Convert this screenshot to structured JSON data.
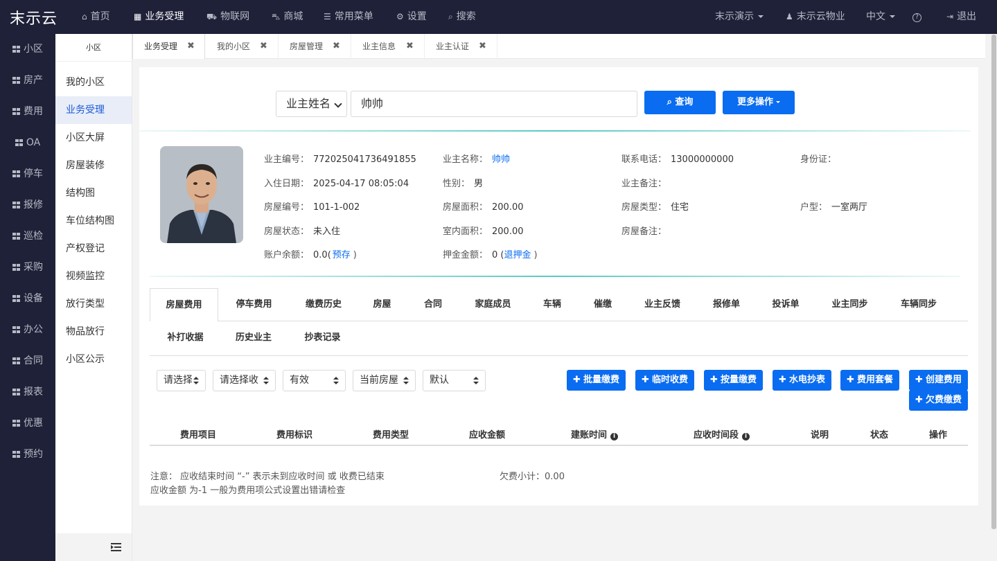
{
  "topbar": {
    "logo": "末示云",
    "nav": [
      {
        "icon": "home-icon",
        "label": "首页"
      },
      {
        "icon": "calculator-icon",
        "label": "业务受理"
      },
      {
        "icon": "car-icon",
        "label": "物联网"
      },
      {
        "icon": "cart-icon",
        "label": "商城"
      },
      {
        "icon": "menu-icon",
        "label": "常用菜单"
      },
      {
        "icon": "gear-icon",
        "label": "设置"
      },
      {
        "icon": "search-icon",
        "label": "搜索"
      }
    ],
    "right": {
      "demo": "末示演示",
      "user": "末示云物业",
      "lang": "中文",
      "help": "?",
      "logout": "退出"
    }
  },
  "leftbar": {
    "items": [
      "小区",
      "房产",
      "费用",
      "OA",
      "停车",
      "报修",
      "巡检",
      "采购",
      "设备",
      "办公",
      "合同",
      "报表",
      "优惠",
      "预约"
    ]
  },
  "subbar": {
    "title": "小区",
    "items": [
      "我的小区",
      "业务受理",
      "小区大屏",
      "房屋装修",
      "结构图",
      "车位结构图",
      "产权登记",
      "视频监控",
      "放行类型",
      "物品放行",
      "小区公示"
    ],
    "active": "业务受理"
  },
  "tabs": [
    "业务受理",
    "我的小区",
    "房屋管理",
    "业主信息",
    "业主认证"
  ],
  "search": {
    "type": "业主姓名",
    "value": "帅帅",
    "query_btn": "查询",
    "more_btn": "更多操作"
  },
  "owner": {
    "labels": {
      "code": "业主编号：",
      "name": "业主名称：",
      "phone": "联系电话：",
      "idcard": "身份证：",
      "checkin": "入住日期：",
      "gender": "性别：",
      "remark": "业主备注：",
      "room_no": "房屋编号：",
      "area": "房屋面积：",
      "room_type": "房屋类型：",
      "layout": "户型：",
      "room_status": "房屋状态：",
      "inner_area": "室内面积：",
      "room_remark": "房屋备注：",
      "balance": "账户余额：",
      "deposit": "押金金额："
    },
    "code": "772025041736491855",
    "name": "帅帅",
    "phone": "13000000000",
    "idcard": "",
    "checkin": "2025-04-17 08:05:04",
    "gender": "男",
    "remark": "",
    "room_no": "101-1-002",
    "area": "200.00",
    "room_type": "住宅",
    "layout": "一室两厅",
    "room_status": "未入住",
    "inner_area": "200.00",
    "room_remark": "",
    "balance": "0.0(",
    "balance_link": "预存",
    "balance_end": ")",
    "deposit": "0 (",
    "deposit_link": "退押金",
    "deposit_end": ")"
  },
  "detail_tabs_row1": [
    "房屋费用",
    "停车费用",
    "缴费历史",
    "房屋",
    "合同",
    "家庭成员",
    "车辆",
    "催缴",
    "业主反馈",
    "报修单",
    "投诉单",
    "业主同步",
    "车辆同步"
  ],
  "detail_tabs_row2": [
    "补打收据",
    "历史业主",
    "抄表记录"
  ],
  "filters": [
    "请选择",
    "请选择收",
    "有效",
    "当前房屋",
    "默认"
  ],
  "actions": [
    "批量缴费",
    "临时收费",
    "按量缴费",
    "水电抄表",
    "费用套餐",
    "创建费用",
    "欠费缴费"
  ],
  "table_headers": [
    "费用项目",
    "费用标识",
    "费用类型",
    "应收金额",
    "建账时间",
    "应收时间段",
    "说明",
    "状态",
    "操作"
  ],
  "notes": {
    "line1": "注意：  应收结束时间 “-” 表示未到应收时间 或 收费已结束",
    "line2": "应收金额 为-1 一般为费用项公式设置出错请检查",
    "arrears_label": "欠费小计：",
    "arrears_value": "0.00"
  },
  "colors": {
    "primary": "#0a6cf0",
    "sidebar": "#1f2138",
    "accent_line": "#58c9c1"
  }
}
